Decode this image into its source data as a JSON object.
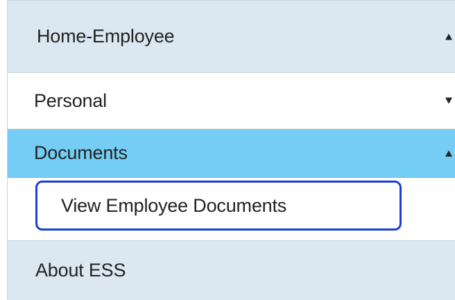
{
  "menu": {
    "home": {
      "label": "Home-Employee",
      "caret": "caret-up-icon"
    },
    "personal": {
      "label": "Personal",
      "caret": "caret-down-icon"
    },
    "documents": {
      "label": "Documents",
      "caret": "caret-up-icon"
    },
    "documents_items": [
      {
        "label": "View Employee Documents",
        "highlighted": true
      }
    ],
    "about": {
      "label": "About ESS"
    }
  },
  "colors": {
    "header_bg": "#dbe8f2",
    "active_bg": "#74cdf4",
    "highlight_border": "#1a3fd8"
  }
}
